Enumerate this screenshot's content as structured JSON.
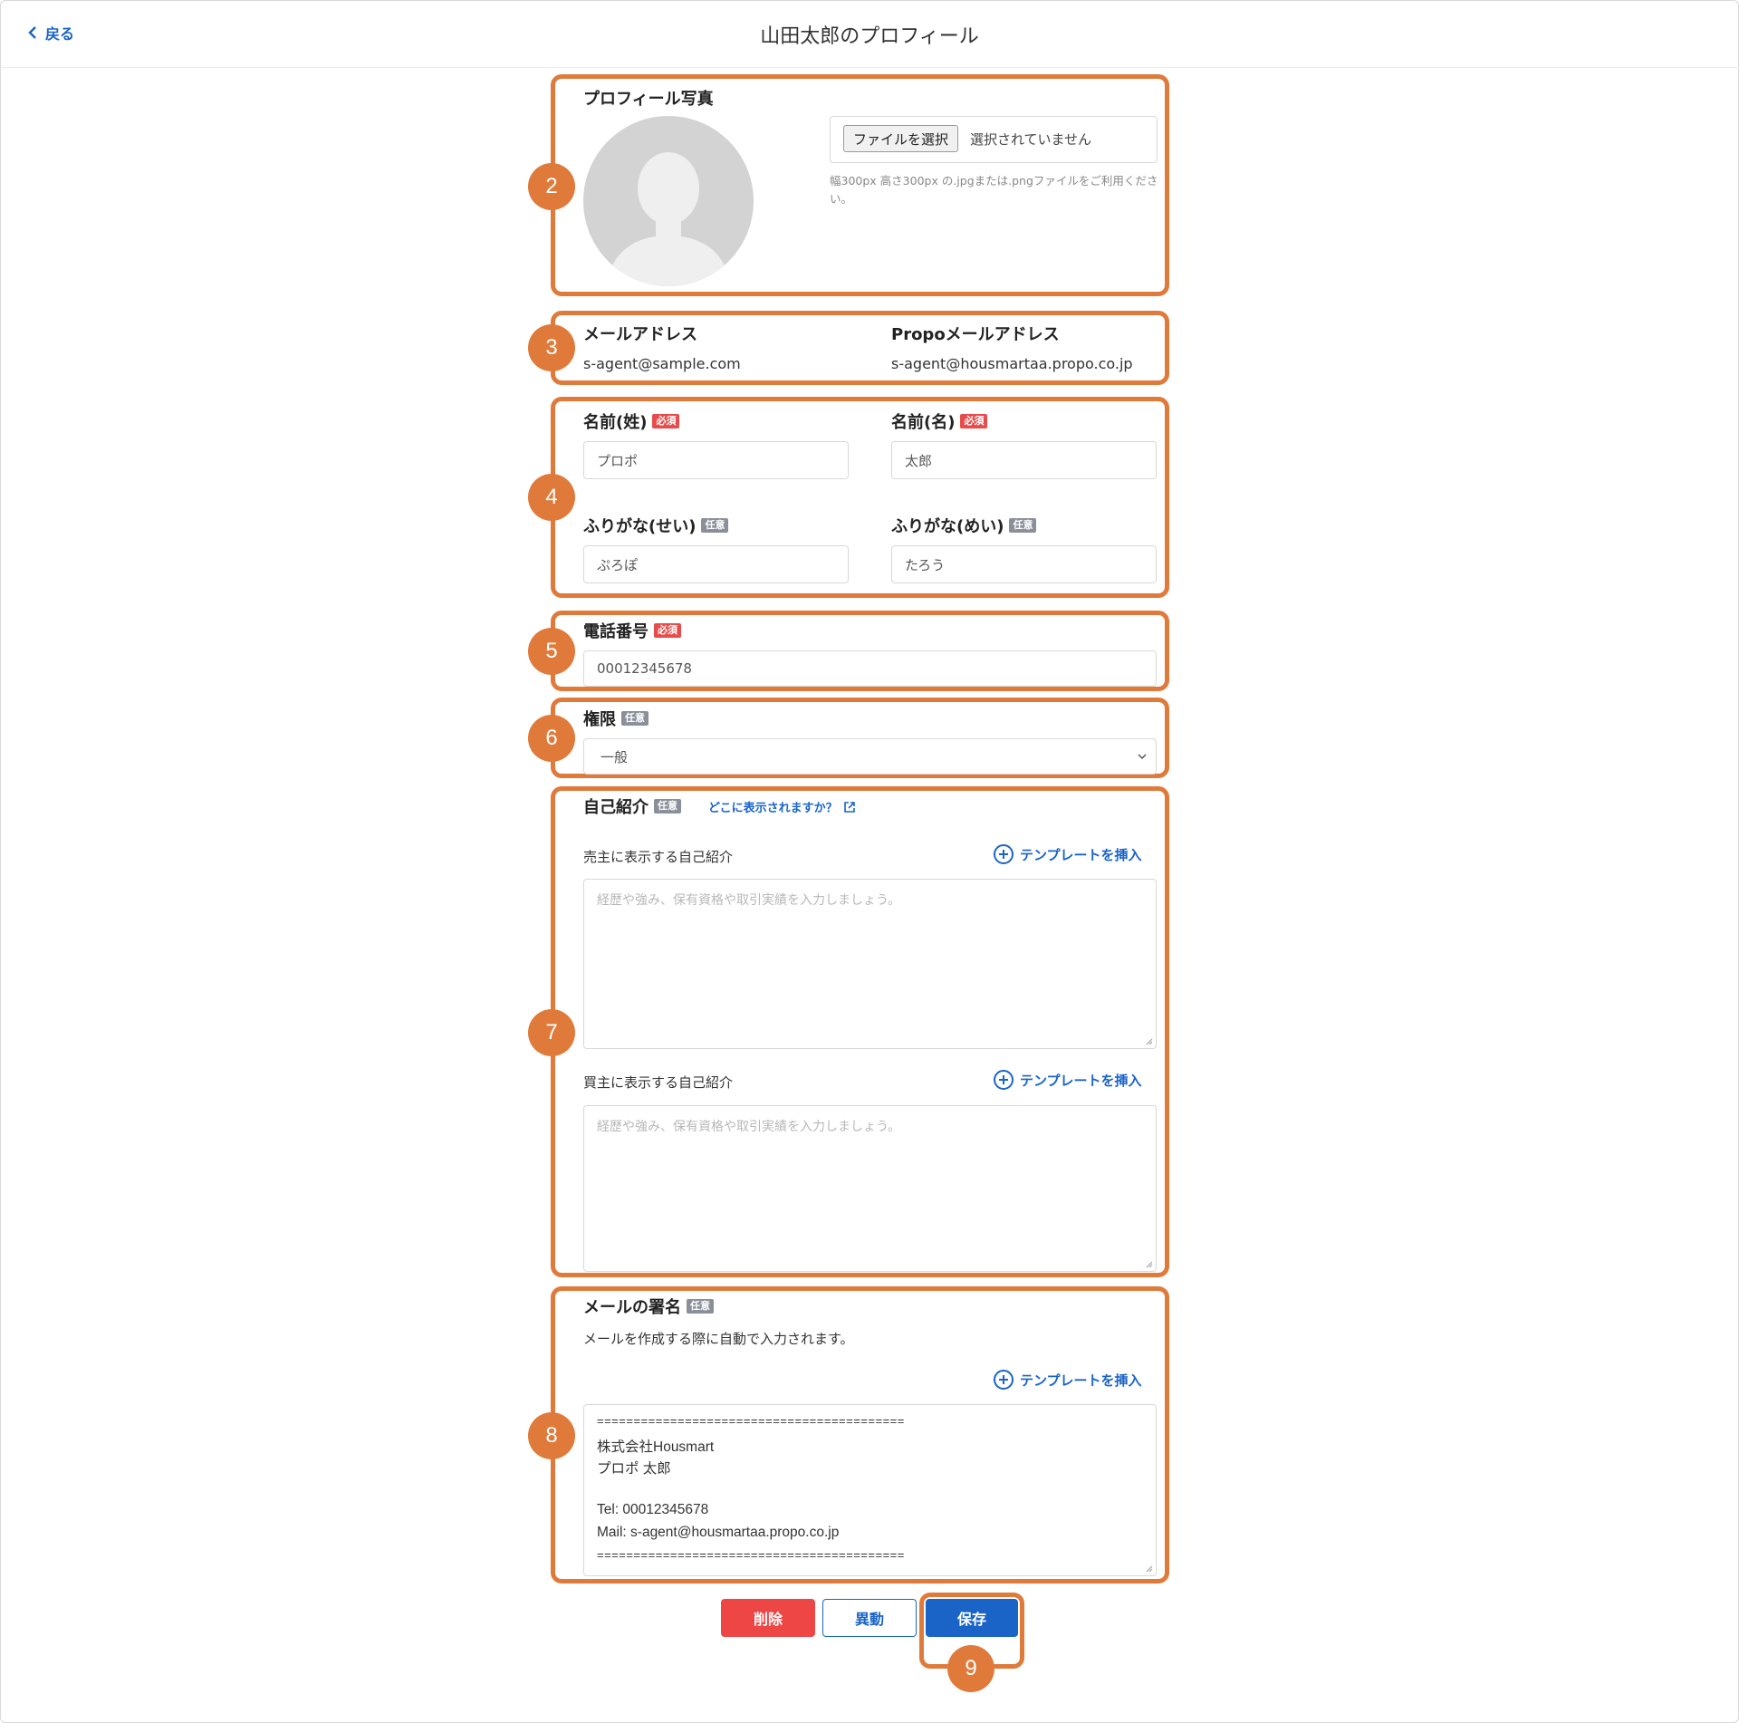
{
  "header": {
    "back_label": "戻る",
    "title": "山田太郎のプロフィール"
  },
  "markers": [
    "2",
    "3",
    "4",
    "5",
    "6",
    "7",
    "8",
    "9"
  ],
  "photo": {
    "label": "プロフィール写真",
    "choose_file": "ファイルを選択",
    "no_file": "選択されていません",
    "hint": "幅300px 高さ300px の.jpgまたは.pngファイルをご利用ください。"
  },
  "email": {
    "label": "メールアドレス",
    "value": "s-agent@sample.com",
    "propo_label": "Propoメールアドレス",
    "propo_value": "s-agent@housmartaa.propo.co.jp"
  },
  "tags": {
    "required": "必須",
    "optional": "任意"
  },
  "name": {
    "last_label": "名前(姓)",
    "last_value": "プロポ",
    "first_label": "名前(名)",
    "first_value": "太郎",
    "last_kana_label": "ふりがな(せい)",
    "last_kana_value": "ぷろぽ",
    "first_kana_label": "ふりがな(めい)",
    "first_kana_value": "たろう"
  },
  "phone": {
    "label": "電話番号",
    "value": "00012345678"
  },
  "role": {
    "label": "権限",
    "selected": "一般"
  },
  "intro": {
    "label": "自己紹介",
    "where_link": "どこに表示されますか？",
    "seller_label": "売主に表示する自己紹介",
    "buyer_label": "買主に表示する自己紹介",
    "insert_template": "テンプレートを挿入",
    "placeholder": "経歴や強み、保有資格や取引実績を入力しましょう。"
  },
  "signature": {
    "label": "メールの署名",
    "description": "メールを作成する際に自動で入力されます。",
    "insert_template": "テンプレートを挿入",
    "lines": [
      "==========================================",
      "株式会社Housmart",
      "プロポ 太郎",
      "",
      "Tel: 00012345678",
      "Mail: s-agent@housmartaa.propo.co.jp",
      "=========================================="
    ]
  },
  "actions": {
    "delete": "削除",
    "transfer": "異動",
    "save": "保存"
  },
  "colors": {
    "accent": "#1a64c8",
    "annotation": "#e07a3a",
    "danger": "#ee4545",
    "required_tag": "#e84b4b",
    "optional_tag": "#8a8f99"
  }
}
